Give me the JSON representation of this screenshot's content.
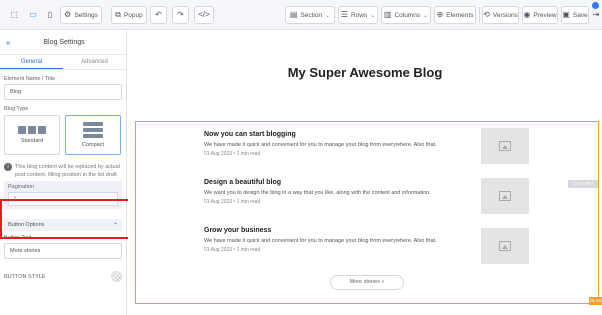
{
  "toolbar": {
    "settings_label": "Settings",
    "popup_label": "Popup",
    "section_label": "Section",
    "rows_label": "Rows",
    "columns_label": "Columns",
    "elements_label": "Elements",
    "versions_label": "Versions",
    "preview_label": "Preview",
    "save_label": "Save",
    "accent_color": "#2d7ff9"
  },
  "sidebar": {
    "back_icon": "double-chevron-left",
    "title": "Blog Settings",
    "tabs": [
      {
        "label": "General",
        "active": true
      },
      {
        "label": "Advanced",
        "active": false
      }
    ],
    "element_name_label": "Element Name / Title",
    "element_name_value": "Blog",
    "blog_type_label": "Blog Type",
    "layouts": [
      {
        "label": "Standard",
        "selected": false
      },
      {
        "label": "Compact",
        "selected": true
      }
    ],
    "note_text": "This blog content will be replaced by actual post content, filling position in the list draft",
    "pagination_label": "Pagination",
    "pagination_value": "›",
    "button_options_label": "Button Options",
    "button_text_label": "Button Text",
    "button_text_value": "More stories",
    "bottom_label": "BUTTON STYLE"
  },
  "canvas": {
    "blog_title": "My Super Awesome Blog",
    "posts": [
      {
        "title": "Now you can start blogging",
        "text": "We have made it quick and convenient for you to manage your blog from everywhere. Also that.",
        "meta": "01 Aug 2023 • 1 min read"
      },
      {
        "title": "Design a beautiful blog",
        "text": "We want you to design the blog in a way that you like, along with the content and information.",
        "meta": "01 Aug 2023 • 1 min read"
      },
      {
        "title": "Grow your business",
        "text": "We have made it quick and convenient for you to manage your blog from everywhere. Also that.",
        "meta": "01 Aug 2023 • 1 min read"
      }
    ],
    "more_button": "More stories »",
    "side_tag": "COLUMN",
    "corner_tag": "BLOG",
    "highlight_color": "#e02020",
    "frame_color": "#f0a030"
  }
}
